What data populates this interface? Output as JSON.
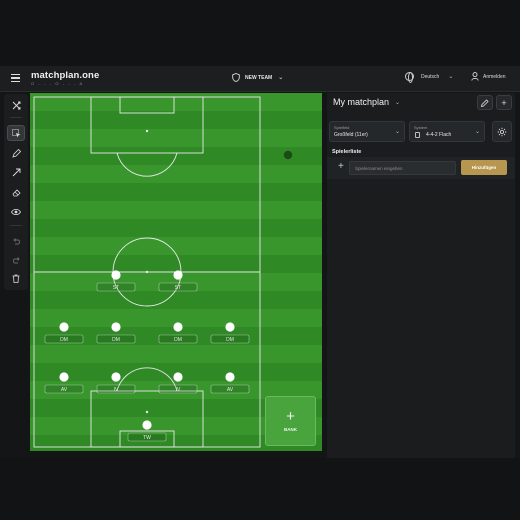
{
  "header": {
    "brand": "matchplan.one",
    "brand_sub": "O - - - O - - - A",
    "team": "NEW TEAM",
    "language": "Deutsch",
    "login": "Anmelden"
  },
  "panel": {
    "title": "My matchplan",
    "spielfeld_caption": "Spielfeld",
    "spielfeld_value": "Großfeld (11er)",
    "system_caption": "System",
    "system_value": "4-4-2 Flach",
    "spielerliste_heading": "Spielerliste",
    "player_input_placeholder": "Spielernamen eingeben",
    "add_button": "Hinzufügen"
  },
  "bench": {
    "label": "BANK"
  },
  "players": [
    {
      "label": "ST",
      "col": 0,
      "row": 0
    },
    {
      "label": "ST",
      "col": 1,
      "row": 0
    },
    {
      "label": "DM",
      "col": 0,
      "row": 1
    },
    {
      "label": "DM",
      "col": 1,
      "row": 1
    },
    {
      "label": "DM",
      "col": 2,
      "row": 1
    },
    {
      "label": "DM",
      "col": 3,
      "row": 1
    },
    {
      "label": "AV",
      "col": 0,
      "row": 2
    },
    {
      "label": "IV",
      "col": 1,
      "row": 2
    },
    {
      "label": "IV",
      "col": 2,
      "row": 2
    },
    {
      "label": "AV",
      "col": 3,
      "row": 2
    },
    {
      "label": "TW",
      "col": 0,
      "row": 3
    }
  ],
  "colors": {
    "pitch_dark": "#2f8a26",
    "pitch_light": "#38962d",
    "accent": "#b79650"
  }
}
